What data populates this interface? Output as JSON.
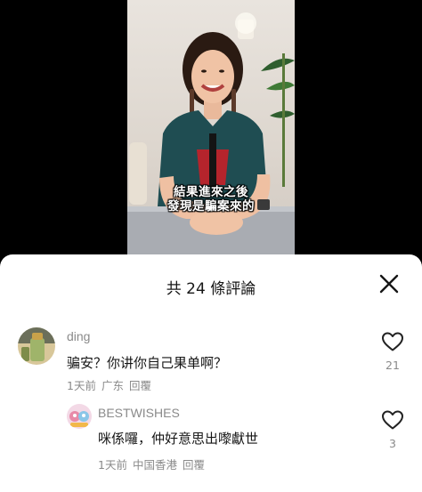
{
  "video": {
    "subtitle_line1": "結果進來之後",
    "subtitle_line2": "發現是騙案來的"
  },
  "sheet": {
    "title": "共 24 條評論"
  },
  "comments": [
    {
      "author": "ding",
      "text": "骗安？你讲你自己果单啊？",
      "time": "1天前",
      "location": "广东",
      "reply_label": "回覆",
      "likes": "21"
    },
    {
      "author": "BESTWISHES",
      "text": "咪係囉，仲好意思出嚟獻世",
      "time": "1天前",
      "location": "中国香港",
      "reply_label": "回覆",
      "likes": "3"
    }
  ],
  "icons": {
    "close": "close-icon",
    "like": "heart-outline-icon"
  },
  "colors": {
    "sheet_background": "#ffffff",
    "primary_text": "#161616",
    "secondary_text": "#8a8a8a"
  }
}
